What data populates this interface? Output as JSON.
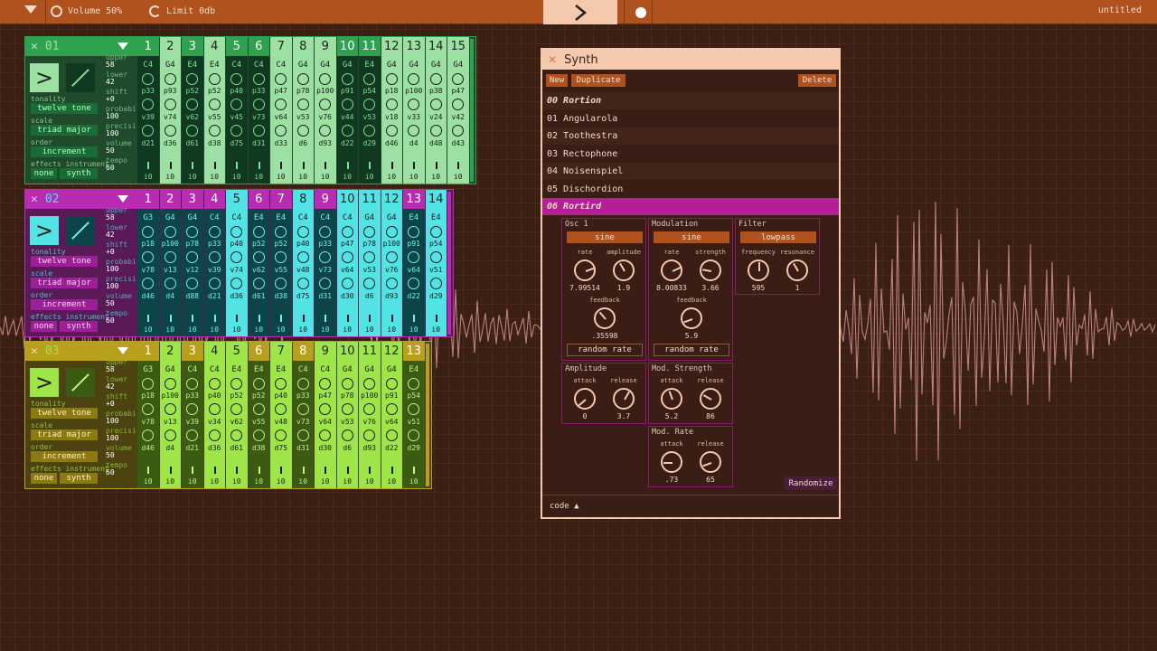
{
  "topbar": {
    "volume": "Volume 50%",
    "limit": "Limit 0db",
    "project": "untitled"
  },
  "tracks": [
    {
      "number": "01",
      "bg": "#1f4a2c",
      "accent": "#2ea24e",
      "light": "#9ce0a3",
      "dark": "#113821",
      "knob": "#7de38f",
      "pillbg": "#1a6b37",
      "pilltxt": "#b8ffc2",
      "tonality": "twelve tone",
      "scale": "triad major",
      "order": "increment",
      "effects": "none",
      "instrument": "synth",
      "upper": "58",
      "lower": "42",
      "shift": "+0",
      "probability": "100",
      "precision": "100",
      "volume": "50",
      "tempo": "60",
      "active": [
        1,
        3,
        6,
        7,
        8,
        11,
        12,
        13,
        14
      ],
      "notes": [
        "C4",
        "G4",
        "E4",
        "E4",
        "C4",
        "C4",
        "C4",
        "G4",
        "G4",
        "G4",
        "E4",
        "G4",
        "G4",
        "G4",
        "G4"
      ],
      "p": [
        "p33",
        "p93",
        "p52",
        "p52",
        "p40",
        "p33",
        "p47",
        "p78",
        "p100",
        "p91",
        "p54",
        "p18",
        "p100",
        "p38",
        "p47"
      ],
      "v": [
        "v39",
        "v74",
        "v62",
        "v55",
        "v45",
        "v73",
        "v64",
        "v53",
        "v76",
        "v44",
        "v53",
        "v18",
        "v33",
        "v24",
        "v42"
      ],
      "d": [
        "d21",
        "d36",
        "d61",
        "d38",
        "d75",
        "d31",
        "d33",
        "d6",
        "d93",
        "d22",
        "d29",
        "d46",
        "d4",
        "d48",
        "d43"
      ]
    },
    {
      "number": "02",
      "bg": "#5a1a57",
      "accent": "#b82cb3",
      "light": "#52e3e5",
      "dark": "#0d4447",
      "knob": "#6ff0f1",
      "pillbg": "#9d1f97",
      "pilltxt": "#ffd2fc",
      "tonality": "twelve tone",
      "scale": "triad major",
      "order": "increment",
      "effects": "none",
      "instrument": "synth",
      "upper": "58",
      "lower": "42",
      "shift": "+0",
      "probability": "100",
      "precision": "100",
      "volume": "50",
      "tempo": "60",
      "active": [
        4,
        7,
        9,
        10,
        11,
        13
      ],
      "notes": [
        "G3",
        "G4",
        "G4",
        "C4",
        "C4",
        "E4",
        "E4",
        "C4",
        "C4",
        "C4",
        "G4",
        "G4",
        "E4",
        "E4"
      ],
      "p": [
        "p18",
        "p100",
        "p78",
        "p33",
        "p40",
        "p52",
        "p52",
        "p40",
        "p33",
        "p47",
        "p78",
        "p100",
        "p91",
        "p54"
      ],
      "v": [
        "v78",
        "v13",
        "v12",
        "v39",
        "v74",
        "v62",
        "v55",
        "v48",
        "v73",
        "v64",
        "v53",
        "v76",
        "v64",
        "v51"
      ],
      "d": [
        "d46",
        "d4",
        "d88",
        "d21",
        "d36",
        "d61",
        "d38",
        "d75",
        "d31",
        "d30",
        "d6",
        "d93",
        "d22",
        "d29"
      ]
    },
    {
      "number": "03",
      "bg": "#4c4310",
      "accent": "#b8a01c",
      "light": "#9ee54a",
      "dark": "#3b5a14",
      "knob": "#c6f27f",
      "pillbg": "#8a7a10",
      "pilltxt": "#fff4b6",
      "tonality": "twelve tone",
      "scale": "triad major",
      "order": "increment",
      "effects": "none",
      "instrument": "synth",
      "upper": "58",
      "lower": "42",
      "shift": "+0",
      "probability": "100",
      "precision": "100",
      "volume": "50",
      "tempo": "60",
      "active": [
        1,
        3,
        4,
        6,
        8,
        9,
        10,
        11,
        13
      ],
      "notes": [
        "G3",
        "G4",
        "C4",
        "C4",
        "E4",
        "E4",
        "E4",
        "C4",
        "C4",
        "G4",
        "G4",
        "G4",
        "E4"
      ],
      "p": [
        "p18",
        "p100",
        "p33",
        "p40",
        "p52",
        "p52",
        "p40",
        "p33",
        "p47",
        "p78",
        "p100",
        "p91",
        "p54"
      ],
      "v": [
        "v78",
        "v13",
        "v39",
        "v34",
        "v62",
        "v55",
        "v48",
        "v73",
        "v64",
        "v53",
        "v76",
        "v64",
        "v51"
      ],
      "d": [
        "d46",
        "d4",
        "d21",
        "d36",
        "d61",
        "d38",
        "d75",
        "d31",
        "d30",
        "d6",
        "d93",
        "d22",
        "d29"
      ]
    }
  ],
  "labels": {
    "tonality": "tonality",
    "scale": "scale",
    "order": "order",
    "effects": "effects instrument",
    "upper": "upper",
    "lower": "lower",
    "shift": "shift",
    "probability": "probabi",
    "precision": "precisi",
    "volume": "volume",
    "tempo": "tempo",
    "last_val": "i0"
  },
  "synth": {
    "title": "Synth",
    "new": "New",
    "duplicate": "Duplicate",
    "delete": "Delete",
    "presets": [
      "00 Rortion",
      "01 Angularola",
      "02 Toothestra",
      "03 Rectophone",
      "04 Noisenspiel",
      "05 Dischordion",
      "06 Rortird"
    ],
    "selected": 6,
    "osc": {
      "title": "Osc 1",
      "wave": "sine",
      "rate_label": "rate",
      "amp_label": "amplitude",
      "rate": "7.99514",
      "amplitude": "1.9",
      "fb_label": "feedback",
      "feedback": ".35598",
      "random": "random rate"
    },
    "mod": {
      "title": "Modulation",
      "wave": "sine",
      "rate_label": "rate",
      "str_label": "strength",
      "rate": "8.00833",
      "strength": "3.66",
      "fb_label": "feedback",
      "feedback": "5.9",
      "random": "random rate"
    },
    "filter": {
      "title": "Filter",
      "type": "lowpass",
      "freq_label": "frequency",
      "res_label": "resonance",
      "frequency": "595",
      "resonance": "1"
    },
    "amp": {
      "title": "Amplitude",
      "attack_label": "attack",
      "release_label": "release",
      "attack": "0",
      "release": "3.7"
    },
    "modstr": {
      "title": "Mod. Strength",
      "attack_label": "attack",
      "release_label": "release",
      "attack": "5.2",
      "release": "86"
    },
    "modrate": {
      "title": "Mod. Rate",
      "attack_label": "attack",
      "release_label": "release",
      "attack": ".73",
      "release": "65"
    },
    "randomize": "Randomize",
    "code": "code ▲"
  }
}
